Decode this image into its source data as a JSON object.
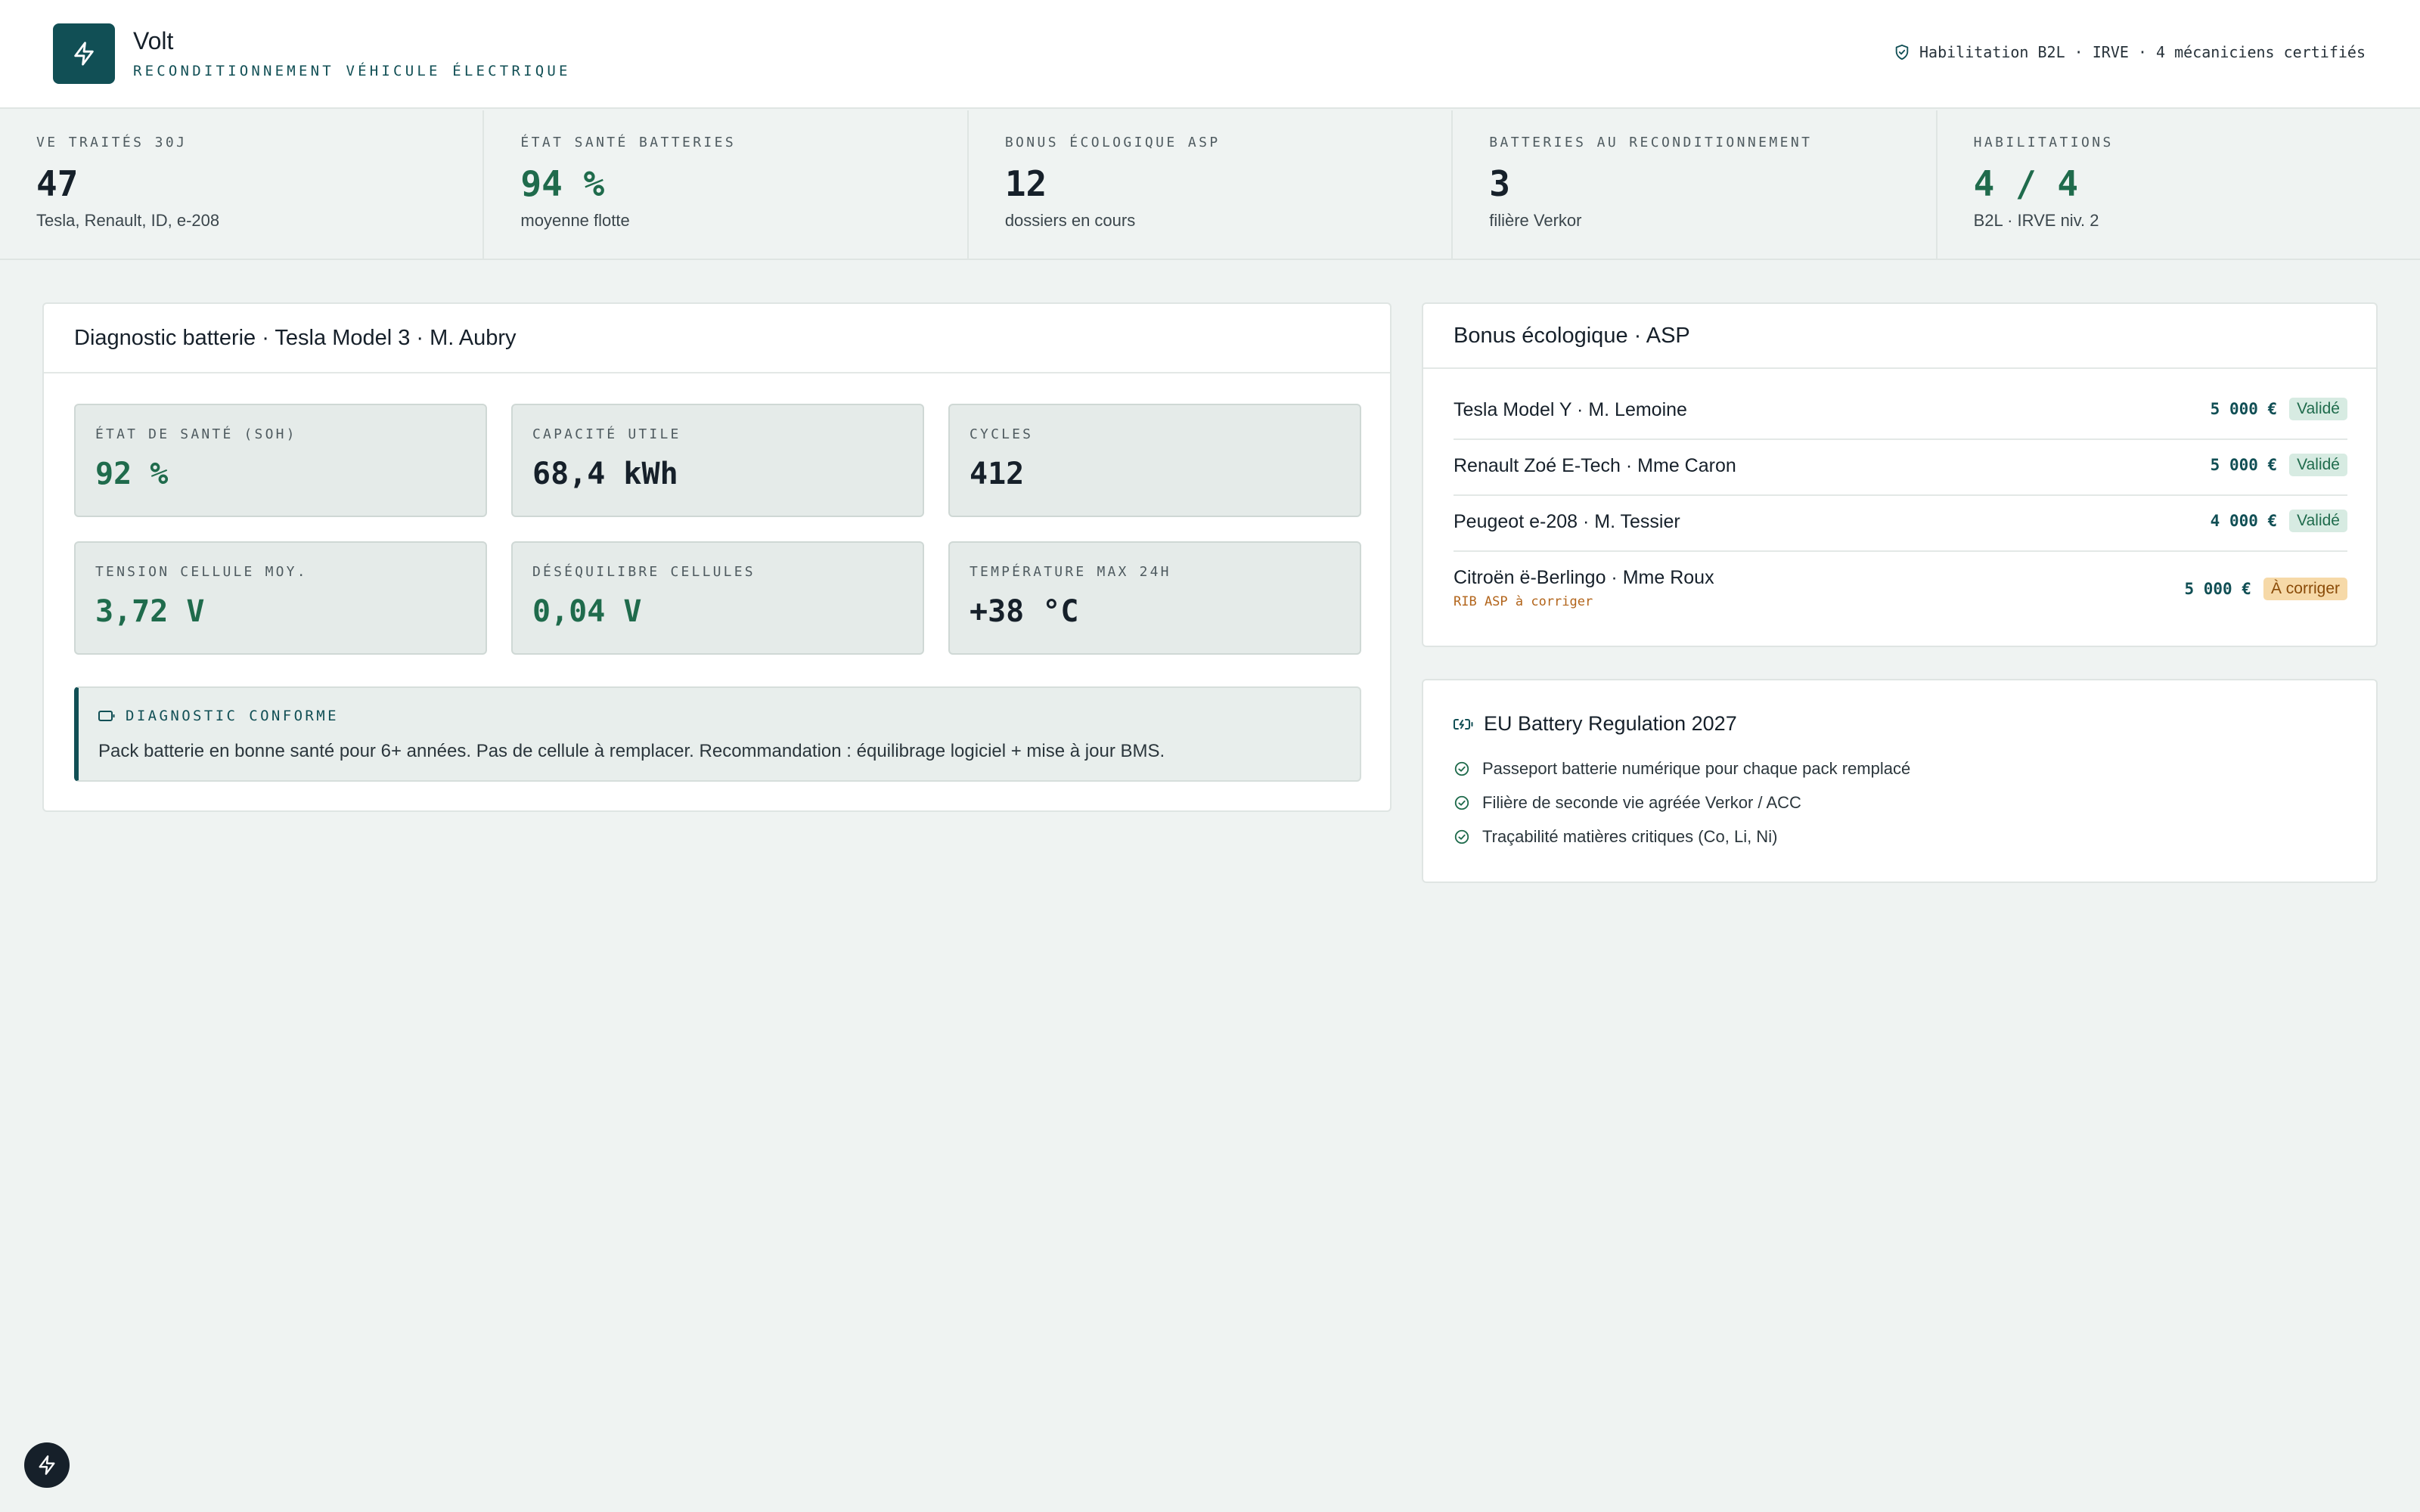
{
  "app": {
    "name": "Volt",
    "subtitle": "RECONDITIONNEMENT VÉHICULE ÉLECTRIQUE",
    "certification": "Habilitation B2L · IRVE · 4 mécaniciens certifiés"
  },
  "kpis": [
    {
      "label": "VE TRAITÉS 30J",
      "value": "47",
      "sub": "Tesla, Renault, ID, e-208"
    },
    {
      "label": "ÉTAT SANTÉ BATTERIES",
      "value": "94 %",
      "sub": "moyenne flotte"
    },
    {
      "label": "BONUS ÉCOLOGIQUE ASP",
      "value": "12",
      "sub": "dossiers en cours"
    },
    {
      "label": "BATTERIES AU RECONDITIONNEMENT",
      "value": "3",
      "sub": "filière Verkor"
    },
    {
      "label": "HABILITATIONS",
      "value": "4 / 4",
      "sub": "B2L · IRVE niv. 2"
    }
  ],
  "diagnostic": {
    "title": "Diagnostic batterie · Tesla Model 3 · M. Aubry",
    "tiles": [
      {
        "label": "ÉTAT DE SANTÉ (SOH)",
        "value": "92 %"
      },
      {
        "label": "CAPACITÉ UTILE",
        "value": "68,4 kWh"
      },
      {
        "label": "CYCLES",
        "value": "412"
      },
      {
        "label": "TENSION CELLULE MOY.",
        "value": "3,72 V"
      },
      {
        "label": "DÉSÉQUILIBRE CELLULES",
        "value": "0,04 V"
      },
      {
        "label": "TEMPÉRATURE MAX 24H",
        "value": "+38 °C"
      }
    ],
    "note": {
      "title": "DIAGNOSTIC CONFORME",
      "text": "Pack batterie en bonne santé pour 6+ années. Pas de cellule à remplacer. Recommandation : équilibrage logiciel + mise à jour BMS."
    }
  },
  "bonus": {
    "title": "Bonus écologique · ASP",
    "rows": [
      {
        "name": "Tesla Model Y · M. Lemoine",
        "amount": "5 000 €",
        "status": "Validé"
      },
      {
        "name": "Renault Zoé E-Tech · Mme Caron",
        "amount": "5 000 €",
        "status": "Validé"
      },
      {
        "name": "Peugeot e-208 · M. Tessier",
        "amount": "4 000 €",
        "status": "Validé"
      },
      {
        "name": "Citroën ë-Berlingo · Mme Roux",
        "amount": "5 000 €",
        "status": "À corriger",
        "sub": "RIB ASP à corriger"
      }
    ]
  },
  "regulation": {
    "title": "EU Battery Regulation 2027",
    "items": [
      "Passeport batterie numérique pour chaque pack remplacé",
      "Filière de seconde vie agréée Verkor / ACC",
      "Traçabilité matières critiques (Co, Li, Ni)"
    ]
  },
  "colors": {
    "brand": "#114f55",
    "positive": "#1f6b4c",
    "warning": "#f6d9a8"
  }
}
